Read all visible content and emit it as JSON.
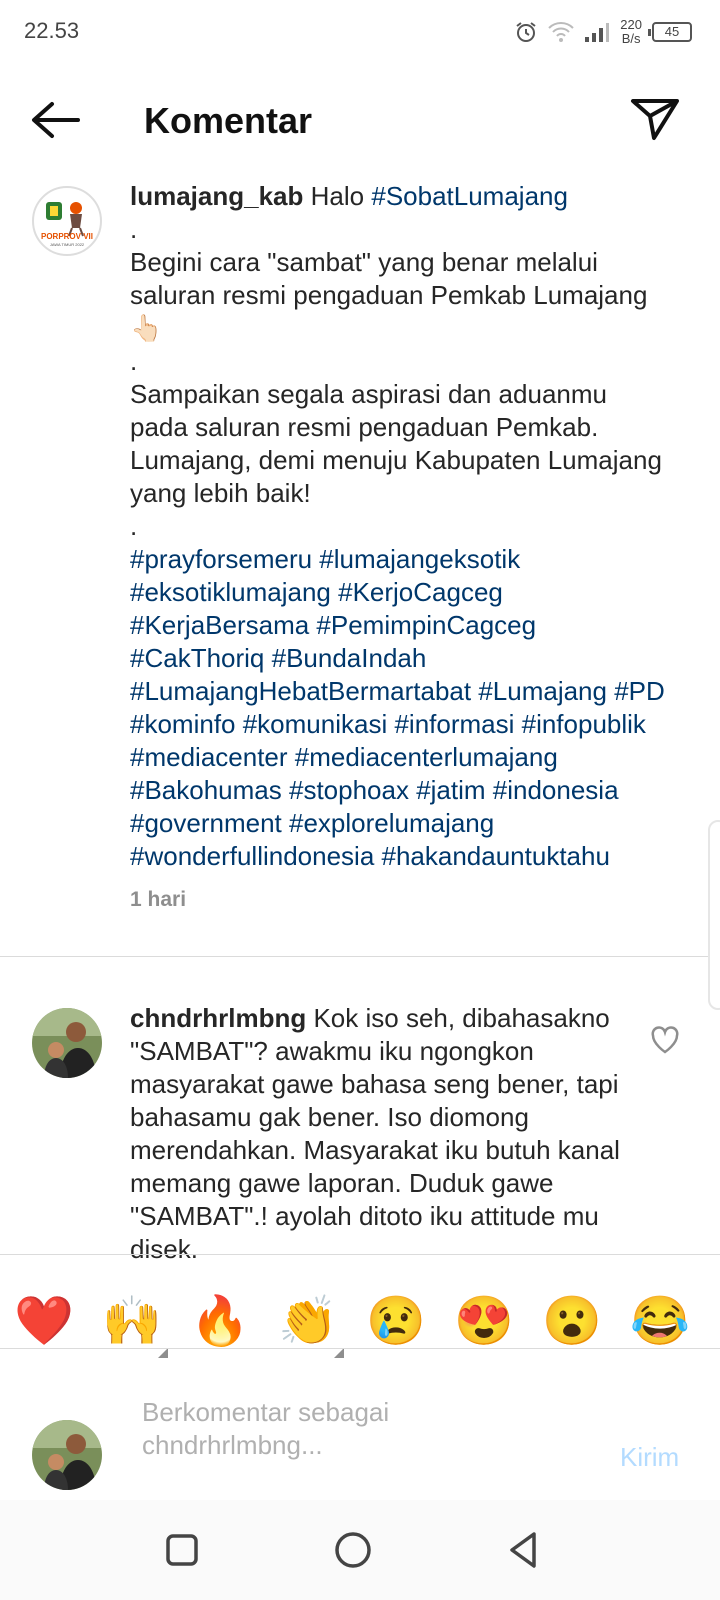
{
  "status_bar": {
    "time": "22.53",
    "network_speed_value": "220",
    "network_speed_unit": "B/s",
    "battery": "45",
    "icons": [
      "alarm-icon",
      "wifi-icon",
      "signal-icon",
      "battery-icon"
    ]
  },
  "header": {
    "title": "Komentar",
    "back_icon": "arrow-left-icon",
    "share_icon": "paper-plane-icon"
  },
  "caption": {
    "username": "lumajang_kab",
    "greeting": "Halo",
    "greeting_tag": "#SobatLumajang",
    "dot": ".",
    "paragraph1": "Begini cara \"sambat\" yang benar melalui saluran resmi pengaduan Pemkab Lumajang",
    "pointing_emoji": "👆🏻",
    "paragraph2": "Sampaikan segala aspirasi dan aduanmu pada saluran resmi pengaduan Pemkab. Lumajang, demi menuju Kabupaten Lumajang yang lebih baik!",
    "hashtags": "#prayforsemeru #lumajangeksotik #eksotiklumajang #KerjoCagceg #KerjaBersama #PemimpinCagceg #CakThoriq #BundaIndah #LumajangHebatBermartabat #Lumajang #PD #kominfo #komunikasi #informasi #infopublik #mediacenter #mediacenterlumajang #Bakohumas #stophoax #jatim #indonesia #government #explorelumajang #wonderfullindonesia #hakandauntuktahu",
    "time": "1 hari",
    "logo_text": "PORPROV VII",
    "logo_subtext": "JAWA TIMUR 2022"
  },
  "comment": {
    "username": "chndrhrlmbng",
    "text": "Kok iso seh, dibahasakno \"SAMBAT\"? awakmu iku ngongkon masyarakat gawe bahasa seng bener, tapi bahasamu gak bener. Iso diomong merendahkan. Masyarakat iku butuh kanal memang gawe laporan. Duduk gawe \"SAMBAT\".! ayolah ditoto iku attitude mu disek."
  },
  "emoji_bar": [
    {
      "name": "red-heart",
      "glyph": "❤️",
      "has_variants": false
    },
    {
      "name": "raising-hands",
      "glyph": "🙌",
      "has_variants": true
    },
    {
      "name": "fire",
      "glyph": "🔥",
      "has_variants": false
    },
    {
      "name": "clapping-hands",
      "glyph": "👏",
      "has_variants": true
    },
    {
      "name": "crying-face",
      "glyph": "😢",
      "has_variants": false
    },
    {
      "name": "heart-eyes",
      "glyph": "😍",
      "has_variants": false
    },
    {
      "name": "surprised-face",
      "glyph": "😮",
      "has_variants": false
    },
    {
      "name": "tears-of-joy",
      "glyph": "😂",
      "has_variants": false
    }
  ],
  "comment_input": {
    "placeholder": "Berkomentar sebagai\nchndrhrlmbng...",
    "post_label": "Kirim"
  },
  "colors": {
    "hashtag": "#00376b",
    "post_button": "#b3dbff",
    "divider": "#dbdbdb",
    "secondary_text": "#8e8e8e"
  },
  "nav_bar": {
    "icons": [
      "square-recents-icon",
      "circle-home-icon",
      "triangle-back-icon"
    ]
  }
}
